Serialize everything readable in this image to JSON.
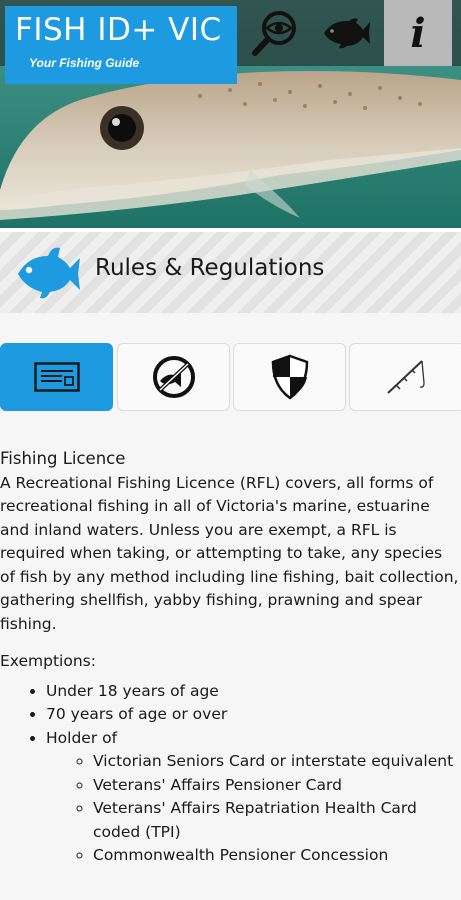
{
  "header": {
    "title": "FISH ID+ VIC",
    "subtitle": "Your Fishing Guide",
    "nav": [
      {
        "icon": "search-eye-icon"
      },
      {
        "icon": "fish-icon"
      },
      {
        "icon": "info-icon",
        "glyph": "i",
        "active": true
      }
    ]
  },
  "section": {
    "label": "Rules & Regulations",
    "icon": "fish-icon",
    "icon_color": "#1e9ae0"
  },
  "tabs": [
    {
      "icon": "licence-card-icon",
      "active": true
    },
    {
      "icon": "no-fishing-icon",
      "active": false
    },
    {
      "icon": "shield-icon",
      "active": false
    },
    {
      "icon": "fishing-rod-icon",
      "active": false
    }
  ],
  "content": {
    "heading": "Fishing Licence",
    "intro": "A Recreational Fishing Licence (RFL) covers, all forms of recreational fishing in all of Victoria's marine, estuarine and inland waters. Unless you are exempt, a RFL is required when taking, or attempting to take, any species of fish by any method including line fishing, bait collection, gathering shellfish, yabby fishing, prawning and spear fishing.",
    "exemptions_label": "Exemptions:",
    "exemptions": [
      "Under 18 years of age",
      "70 years of age or over",
      "Holder of"
    ],
    "holder_of": [
      "Victorian Seniors Card or interstate equivalent",
      "Veterans' Affairs Pensioner Card",
      "Veterans' Affairs Repatriation Health Card coded (TPI)",
      "Commonwealth Pensioner Concession"
    ]
  },
  "colors": {
    "accent": "#1e9ae0",
    "active_nav": "#b9b9b9"
  }
}
